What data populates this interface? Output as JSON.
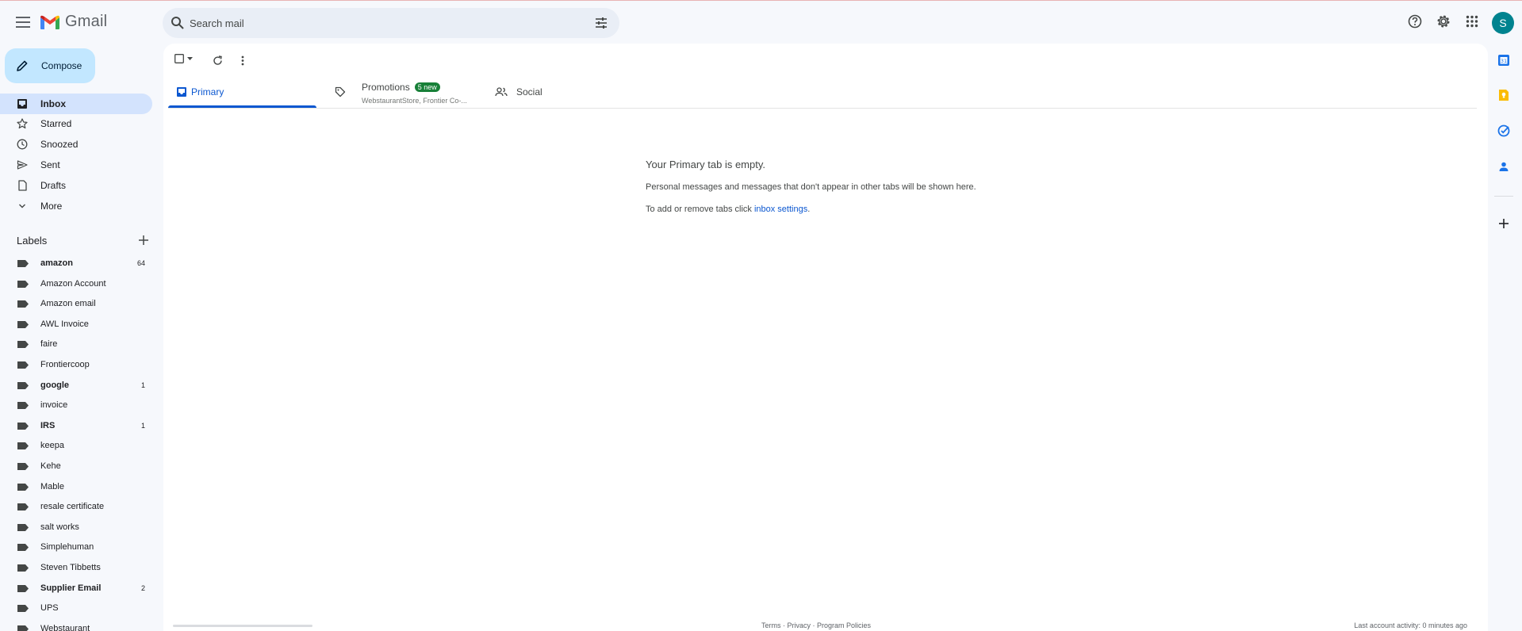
{
  "app": {
    "name": "Gmail"
  },
  "search": {
    "placeholder": "Search mail"
  },
  "compose": {
    "label": "Compose"
  },
  "nav": [
    {
      "label": "Inbox",
      "icon": "inbox-icon",
      "active": true
    },
    {
      "label": "Starred",
      "icon": "star-icon"
    },
    {
      "label": "Snoozed",
      "icon": "clock-icon"
    },
    {
      "label": "Sent",
      "icon": "send-icon"
    },
    {
      "label": "Drafts",
      "icon": "draft-icon"
    },
    {
      "label": "More",
      "icon": "chevron-down-icon"
    }
  ],
  "labels": {
    "title": "Labels",
    "items": [
      {
        "name": "amazon",
        "count": "64",
        "bold": true
      },
      {
        "name": "Amazon Account",
        "count": ""
      },
      {
        "name": "Amazon email",
        "count": ""
      },
      {
        "name": "AWL Invoice",
        "count": ""
      },
      {
        "name": "faire",
        "count": ""
      },
      {
        "name": "Frontiercoop",
        "count": ""
      },
      {
        "name": "google",
        "count": "1",
        "bold": true
      },
      {
        "name": "invoice",
        "count": ""
      },
      {
        "name": "IRS",
        "count": "1",
        "bold": true
      },
      {
        "name": "keepa",
        "count": ""
      },
      {
        "name": "Kehe",
        "count": ""
      },
      {
        "name": "Mable",
        "count": ""
      },
      {
        "name": "resale certificate",
        "count": ""
      },
      {
        "name": "salt works",
        "count": ""
      },
      {
        "name": "Simplehuman",
        "count": ""
      },
      {
        "name": "Steven Tibbetts",
        "count": ""
      },
      {
        "name": "Supplier Email",
        "count": "2",
        "bold": true
      },
      {
        "name": "UPS",
        "count": ""
      },
      {
        "name": "Webstaurant",
        "count": ""
      }
    ]
  },
  "tabs": {
    "primary": {
      "label": "Primary"
    },
    "promotions": {
      "label": "Promotions",
      "badge": "5 new",
      "subtitle": "WebstaurantStore, Frontier Co-..."
    },
    "social": {
      "label": "Social"
    }
  },
  "empty_state": {
    "title": "Your Primary tab is empty.",
    "line1": "Personal messages and messages that don't appear in other tabs will be shown here.",
    "line2_prefix": "To add or remove tabs click ",
    "line2_link": "inbox settings",
    "line2_suffix": "."
  },
  "footer": {
    "terms": "Terms",
    "sep": " · ",
    "privacy": "Privacy",
    "policies": "Program Policies",
    "activity": "Last account activity: 0 minutes ago"
  },
  "user": {
    "initial": "S",
    "avatar_color": "#00838f"
  },
  "colors": {
    "accent": "#0b57d0",
    "compose_bg": "#c2e7ff",
    "active_nav": "#d3e3fd",
    "badge": "#188038"
  }
}
